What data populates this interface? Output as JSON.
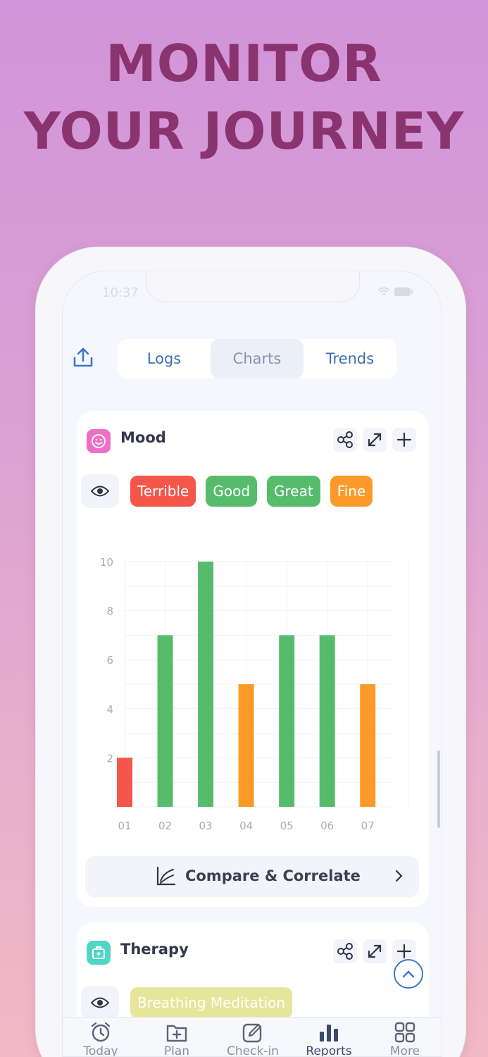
{
  "headline": {
    "line1": "MONITOR",
    "line2": "YOUR JOURNEY"
  },
  "status": {
    "time": "10:37"
  },
  "segmented": {
    "tabs": [
      "Logs",
      "Charts",
      "Trends"
    ],
    "active": "Charts"
  },
  "mood": {
    "title": "Mood",
    "chips": [
      {
        "label": "Terrible",
        "color": "#f4574a"
      },
      {
        "label": "Good",
        "color": "#56bc6c"
      },
      {
        "label": "Great",
        "color": "#56bc6c"
      },
      {
        "label": "Fine",
        "color": "#fb9a29"
      }
    ],
    "compare_label": "Compare & Correlate"
  },
  "chart_data": {
    "type": "bar",
    "categories": [
      "01",
      "02",
      "03",
      "04",
      "05",
      "06",
      "07"
    ],
    "values": [
      2,
      7,
      10,
      5,
      7,
      7,
      5
    ],
    "bar_colors": [
      "#f4574a",
      "#56bc6c",
      "#56bc6c",
      "#fb9a29",
      "#56bc6c",
      "#56bc6c",
      "#fb9a29"
    ],
    "yticks": [
      2,
      4,
      6,
      8,
      10
    ],
    "ylim": [
      0,
      10
    ],
    "grid": true
  },
  "therapy": {
    "title": "Therapy",
    "chips": [
      {
        "label": "Breathing Meditation",
        "color": "#e6e69a"
      }
    ]
  },
  "tabbar": {
    "items": [
      "Today",
      "Plan",
      "Check-in",
      "Reports",
      "More"
    ],
    "active": "Reports"
  }
}
